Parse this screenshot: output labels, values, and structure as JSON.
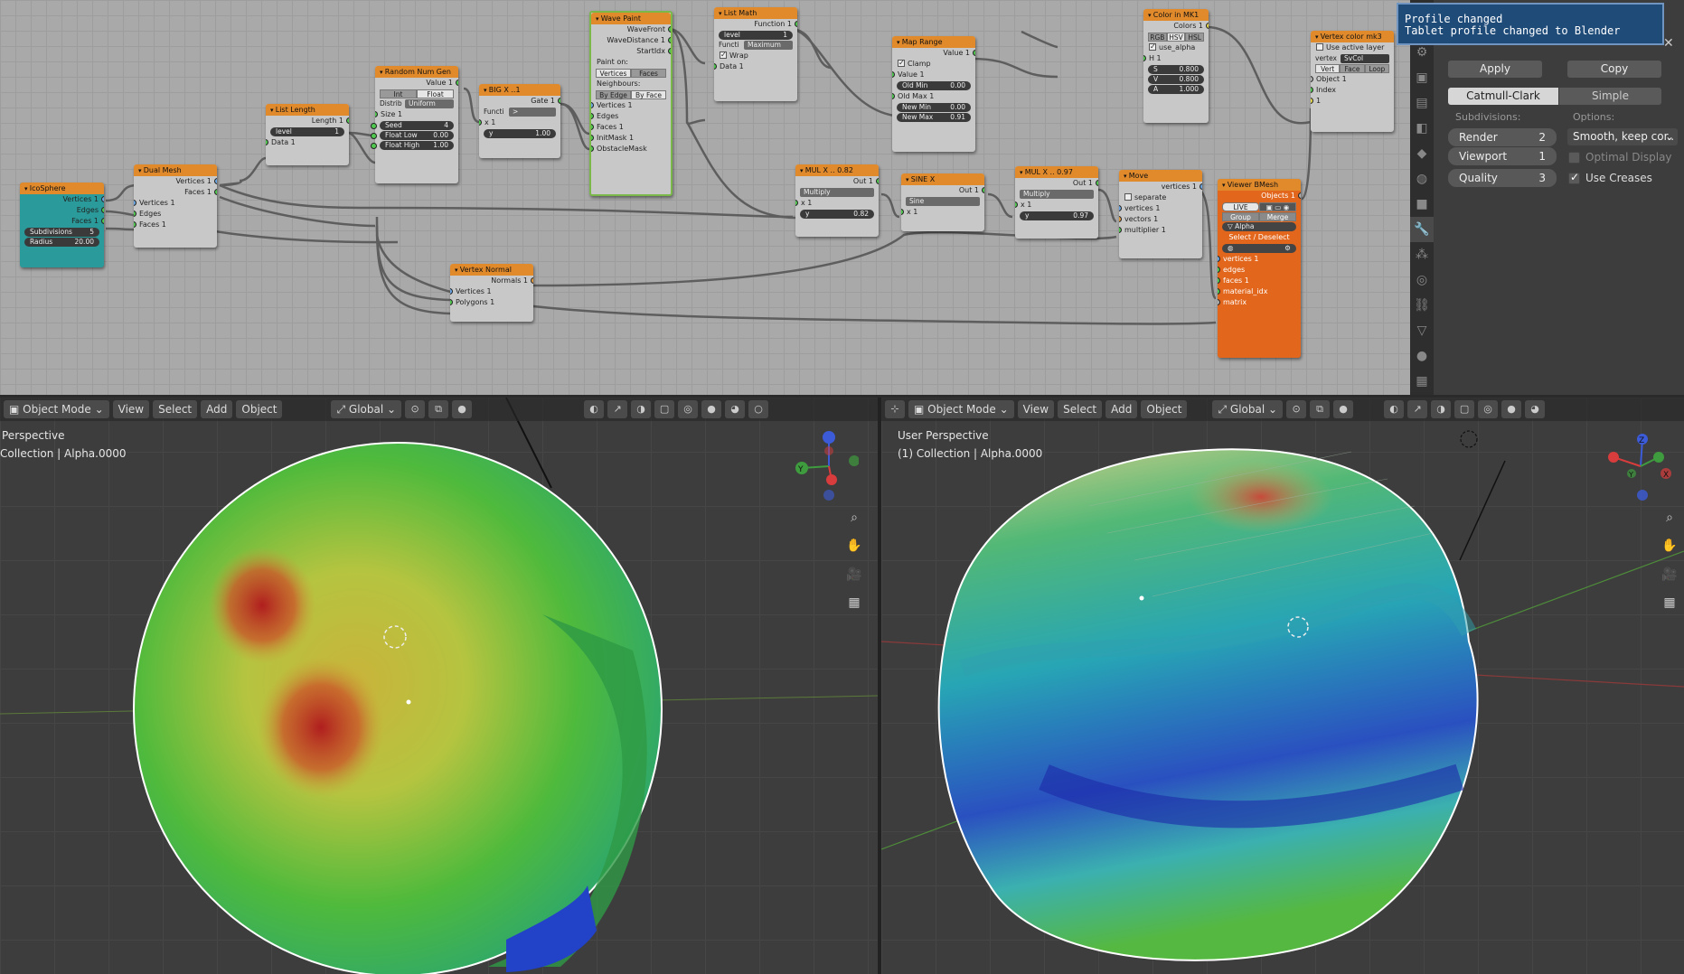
{
  "toast": {
    "title": "Profile changed",
    "message": "Tablet profile changed to Blender"
  },
  "properties": {
    "apply_label": "Apply",
    "copy_label": "Copy",
    "type_options": [
      "Catmull-Clark",
      "Simple"
    ],
    "selected_type": "Catmull-Clark",
    "subdivisions_label": "Subdivisions:",
    "options_label": "Options:",
    "render_label": "Render",
    "render_value": "2",
    "viewport_label": "Viewport",
    "viewport_value": "1",
    "quality_label": "Quality",
    "quality_value": "3",
    "uv_smooth_value": "Smooth, keep cor..",
    "optimal_display_label": "Optimal Display",
    "optimal_display_checked": false,
    "use_creases_label": "Use Creases",
    "use_creases_checked": true
  },
  "nodes": {
    "icosphere": {
      "title": "IcoSphere",
      "outputs": [
        "Vertices 1",
        "Edges",
        "Faces 1"
      ],
      "subdivisions_label": "Subdivisions",
      "subdivisions_value": "5",
      "radius_label": "Radius",
      "radius_value": "20.00"
    },
    "dual_mesh": {
      "title": "Dual Mesh",
      "outputs": [
        "Vertices 1",
        "Faces 1"
      ],
      "inputs": [
        "Vertices 1",
        "Edges",
        "Faces 1"
      ]
    },
    "list_length": {
      "title": "List Length",
      "output": "Length 1",
      "level_label": "level",
      "level_value": "1",
      "input": "Data 1"
    },
    "random_num": {
      "title": "Random Num Gen",
      "output": "Value 1",
      "mode_options": [
        "Int",
        "Float"
      ],
      "mode_selected": "Float",
      "distrib_label": "Distrib",
      "distrib_value": "Uniform",
      "size_label": "Size 1",
      "seed_label": "Seed",
      "seed_value": "4",
      "float_low_label": "Float Low",
      "float_low_value": "0.00",
      "float_high_label": "Float High",
      "float_high_value": "1.00"
    },
    "big_x": {
      "title": "BIG X ..1",
      "output": "Gate 1",
      "func_label": "Functi",
      "func_value": ">",
      "x_label": "x 1",
      "y_label": "y",
      "y_value": "1.00"
    },
    "wave_paint": {
      "title": "Wave Paint",
      "outputs": [
        "WaveFront",
        "WaveDistance 1",
        "StartIdx"
      ],
      "paint_on_label": "Paint on:",
      "paint_on_options": [
        "Vertices",
        "Faces"
      ],
      "paint_on_selected": "Vertices",
      "neighbours_label": "Neighbours:",
      "neighbours_options": [
        "By Edge",
        "By Face"
      ],
      "neighbours_selected": "By Face",
      "inputs": [
        "Vertices 1",
        "Edges",
        "Faces 1",
        "InitMask 1",
        "ObstacleMask"
      ]
    },
    "list_math": {
      "title": "List Math",
      "output": "Function 1",
      "level_label": "level",
      "level_value": "1",
      "func_label": "Functi",
      "func_value": "Maximum",
      "wrap_label": "Wrap",
      "input": "Data 1"
    },
    "map_range": {
      "title": "Map Range",
      "output": "Value 1",
      "clamp_label": "Clamp",
      "inputs": [
        "Value 1",
        "Old Min",
        "Old Max 1",
        "New Min",
        "New Max"
      ],
      "old_min_value": "0.00",
      "new_min_value": "0.00",
      "new_max_value": "0.91"
    },
    "color_in": {
      "title": "Color in MK1",
      "output": "Colors 1",
      "modes": [
        "RGB",
        "HSV",
        "HSL"
      ],
      "mode_selected": "HSV",
      "use_alpha_label": "use_alpha",
      "h_label": "H 1",
      "s_label": "S",
      "s_value": "0.800",
      "v_label": "V",
      "v_value": "0.800",
      "a_label": "A",
      "a_value": "1.000"
    },
    "vertex_color": {
      "title": "Vertex color mk3",
      "use_active_layer": "Use active layer",
      "vertex_label": "vertex",
      "vertex_value": "SvCol",
      "modes": [
        "Vert",
        "Face",
        "Loop"
      ],
      "inputs": [
        "Object 1",
        "Index",
        "1"
      ]
    },
    "mul_a": {
      "title": "MUL X .. 0.82",
      "output": "Out 1",
      "func_value": "Multiply",
      "x_label": "x 1",
      "y_label": "y",
      "y_value": "0.82"
    },
    "sine": {
      "title": "SINE X",
      "output": "Out 1",
      "func_value": "Sine",
      "x_label": "x 1"
    },
    "mul_b": {
      "title": "MUL X .. 0.97",
      "output": "Out 1",
      "func_value": "Multiply",
      "x_label": "x 1",
      "y_label": "y",
      "y_value": "0.97"
    },
    "move": {
      "title": "Move",
      "output": "vertices 1",
      "separate_label": "separate",
      "inputs": [
        "vertices 1",
        "vectors 1",
        "multiplier 1"
      ]
    },
    "viewer": {
      "title": "Viewer BMesh",
      "output": "Objects 1",
      "live_label": "LIVE",
      "group_label": "Group",
      "merge_label": "Merge",
      "alpha_label": "Alpha",
      "select_label": "Select / Deselect",
      "inputs": [
        "vertices 1",
        "edges",
        "faces 1",
        "material_idx",
        "matrix"
      ]
    },
    "vertex_normal": {
      "title": "Vertex Normal",
      "output": "Normals 1",
      "inputs": [
        "Vertices 1",
        "Polygons 1"
      ]
    }
  },
  "viewport_left": {
    "mode": "Object Mode",
    "menus": [
      "View",
      "Select",
      "Add",
      "Object"
    ],
    "transform": "Global",
    "view_name": "Perspective",
    "collection": "Collection | Alpha.0000"
  },
  "viewport_right": {
    "mode": "Object Mode",
    "menus": [
      "View",
      "Select",
      "Add",
      "Object"
    ],
    "transform": "Global",
    "view_name": "User Perspective",
    "collection": "(1) Collection | Alpha.0000"
  },
  "colors": {
    "node_header_orange": "#e08a2c",
    "icosphere_teal": "#2a9a9a",
    "wave_paint_green": "#7ab84a",
    "viewer_orange": "#e2671c",
    "toast_blue": "#1f4b79"
  }
}
